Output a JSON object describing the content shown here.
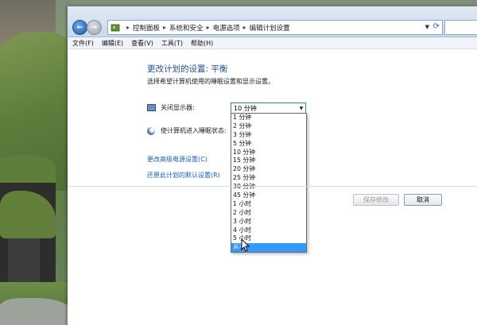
{
  "breadcrumb": [
    "控制面板",
    "系统和安全",
    "电源选项",
    "编辑计划设置"
  ],
  "menu": [
    "文件(F)",
    "编辑(E)",
    "查看(V)",
    "工具(T)",
    "帮助(H)"
  ],
  "page": {
    "title": "更改计划的设置: 平衡",
    "subtitle": "选择希望计算机使用的睡眠设置和显示设置。"
  },
  "display_setting": {
    "label": "关闭显示器:",
    "selected": "10 分钟",
    "options": [
      "1 分钟",
      "2 分钟",
      "3 分钟",
      "5 分钟",
      "10 分钟",
      "15 分钟",
      "20 分钟",
      "25 分钟",
      "30 分钟",
      "45 分钟",
      "1 小时",
      "2 小时",
      "3 小时",
      "4 小时",
      "5 小时",
      "从不"
    ],
    "highlighted": "从不"
  },
  "sleep_setting": {
    "label": "使计算机进入睡眠状态:"
  },
  "links": {
    "advanced": "更改高级电源设置(C)",
    "restore": "还原此计划的默认设置(R)"
  },
  "buttons": {
    "save": "保存修改",
    "cancel": "取消"
  },
  "colors": {
    "accent": "#3399ff",
    "link": "#1a5fb4",
    "title": "#1d4f91"
  },
  "icons": [
    "back-arrow-icon",
    "forward-arrow-icon",
    "control-panel-icon",
    "refresh-icon",
    "display-icon",
    "sleep-moon-icon",
    "mouse-cursor-icon"
  ]
}
